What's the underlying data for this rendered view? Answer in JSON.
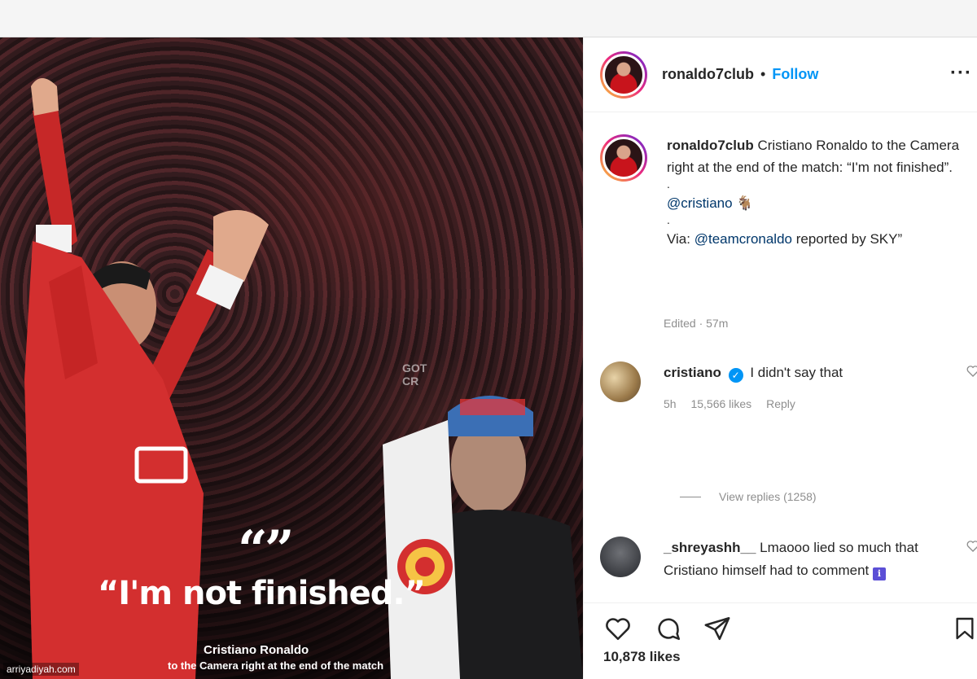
{
  "post": {
    "author": "ronaldo7club",
    "dot": "•",
    "follow_label": "Follow",
    "more_label": "···",
    "image": {
      "quote_marks": "“”",
      "quote_text": "“I'm not finished.”",
      "caption_name": "Cristiano Ronaldo",
      "caption_sub": "to the Camera right at the end of the match",
      "watermark_line1": "GOT",
      "watermark_line2": "CR"
    },
    "caption": {
      "username": "ronaldo7club",
      "text": "Cristiano Ronaldo to the Camera right at the end of the match: “I'm not finished”.",
      "sep1": ".",
      "mention": "@cristiano",
      "mention_emoji": "🐐",
      "sep2": ".",
      "via_prefix": "Via:",
      "via_mention": "@teamcronaldo",
      "via_suffix": "reported by SKY”",
      "edited": "Edited · 57m"
    },
    "comments": [
      {
        "username": "cristiano",
        "verified_mark": "✓",
        "text": "I didn't say that",
        "time": "5h",
        "likes": "15,566 likes",
        "reply": "Reply",
        "view_replies": "View replies (1258)"
      },
      {
        "username": "_shreyashh__",
        "text": "Lmaooo lied so much that Cristiano himself had to comment",
        "emoji": "ℹ"
      }
    ],
    "likes": "10,878 likes"
  },
  "watermark": "arriyadiyah.com"
}
